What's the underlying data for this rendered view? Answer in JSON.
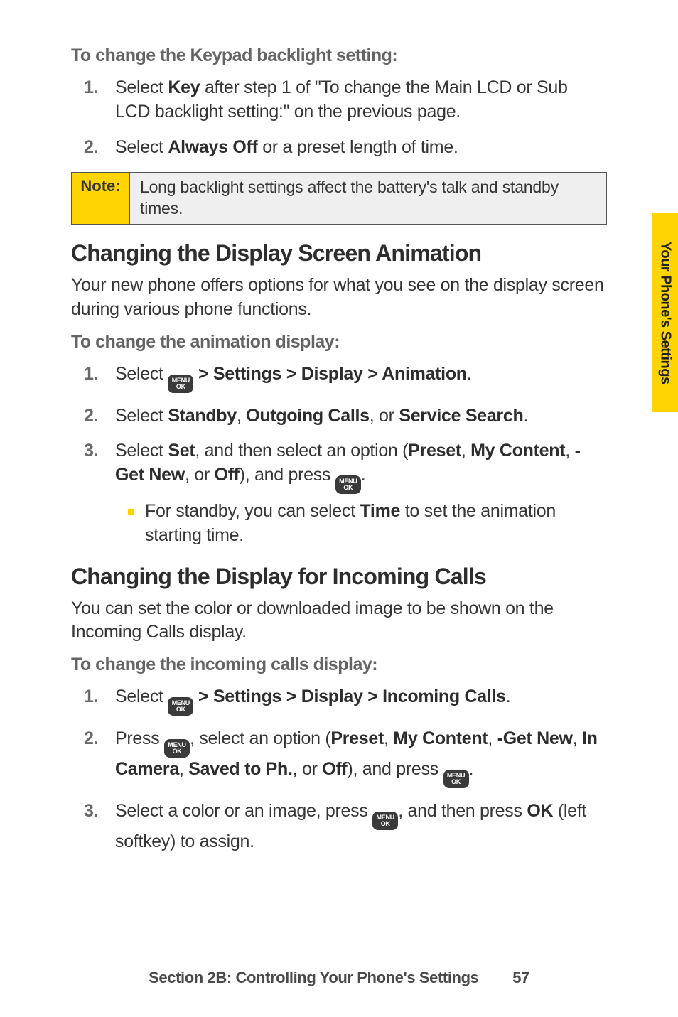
{
  "sideTab": "Your Phone's Settings",
  "menuIcon": {
    "line1": "MENU",
    "line2": "OK"
  },
  "sec1": {
    "lead": "To change the Keypad backlight setting:",
    "steps": [
      {
        "pre": "Select ",
        "b1": "Key",
        "post": " after step 1 of \"To change the Main LCD or Sub LCD backlight setting:\" on the previous page."
      },
      {
        "pre": "Select ",
        "b1": "Always Off",
        "post": " or a preset length of time."
      }
    ]
  },
  "note": {
    "label": "Note:",
    "text": "Long backlight settings affect the battery's talk and standby times."
  },
  "sec2": {
    "heading": "Changing the Display Screen Animation",
    "intro": "Your new phone offers options for what you see on the display screen during various phone functions.",
    "lead": "To change the animation display:",
    "step1": {
      "pre": "Select ",
      "path": " > Settings > Display > Animation",
      "post": "."
    },
    "step2": {
      "pre": "Select ",
      "b1": "Standby",
      "sep1": ", ",
      "b2": "Outgoing Calls",
      "sep2": ", or ",
      "b3": "Service Search",
      "post": "."
    },
    "step3": {
      "pre": "Select ",
      "b1": "Set",
      "mid": ", and then select an option (",
      "b2": "Preset",
      "sep1": ", ",
      "b3": "My Content",
      "sep2": ", ",
      "b4": "-Get New",
      "sep3": ", or ",
      "b5": "Off",
      "closeParen": "), and press ",
      "post": "."
    },
    "bullet": {
      "pre": "For standby, you can select ",
      "b1": "Time",
      "post": " to set the animation starting time."
    }
  },
  "sec3": {
    "heading": "Changing the Display for Incoming Calls",
    "intro": "You can set the color or downloaded image to be shown on the Incoming Calls display.",
    "lead": "To change the incoming calls display:",
    "step1": {
      "pre": "Select ",
      "path": " > Settings > Display > Incoming Calls",
      "post": "."
    },
    "step2": {
      "pre": "Press ",
      "mid": ", select an option (",
      "b1": "Preset",
      "sep1": ", ",
      "b2": "My Content",
      "sep2": ", ",
      "b3": "-Get New",
      "sep3": ", ",
      "b4": "In Camera",
      "sep4": ", ",
      "b5": "Saved to Ph.",
      "sep5": ", or ",
      "b6": "Off",
      "closeParen": "), and press ",
      "post": "."
    },
    "step3": {
      "pre": "Select a color or an image, press ",
      "mid": ", and then press ",
      "b1": "OK",
      "post": " (left softkey) to assign."
    }
  },
  "footer": {
    "text": "Section 2B: Controlling Your Phone's Settings",
    "page": "57"
  }
}
